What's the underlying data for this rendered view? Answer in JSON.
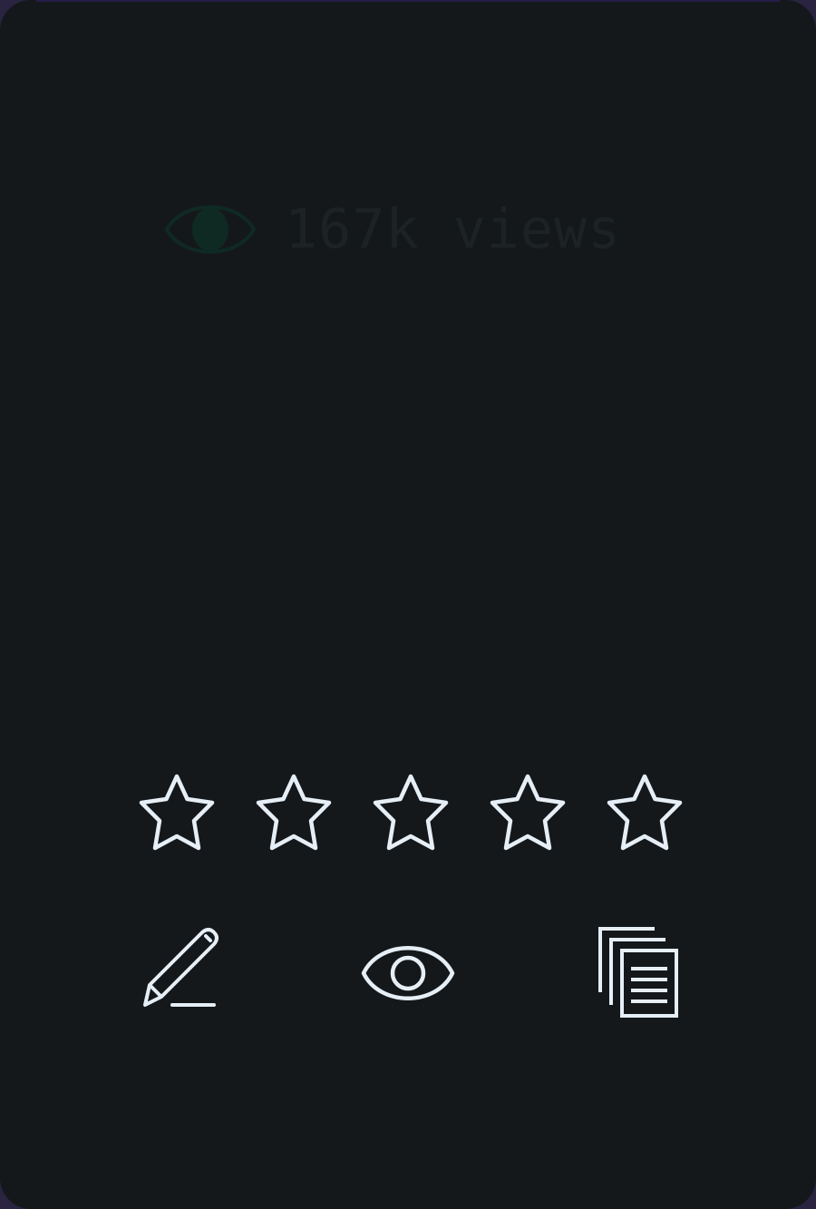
{
  "stats": {
    "views_label": "167k views",
    "views_icon": "eye-icon",
    "views_icon_color": "#0f2a22",
    "views_text_color": "#1d2225"
  },
  "rating": {
    "value": 0,
    "max": 5,
    "icon": "star-outline-icon",
    "stroke_color": "#e6eef6"
  },
  "actions": [
    {
      "name": "edit",
      "icon": "pencil-icon"
    },
    {
      "name": "view",
      "icon": "eye-icon"
    },
    {
      "name": "copy",
      "icon": "documents-icon"
    }
  ],
  "colors": {
    "card_background": "#14181b",
    "icon_stroke": "#e6eef6"
  }
}
